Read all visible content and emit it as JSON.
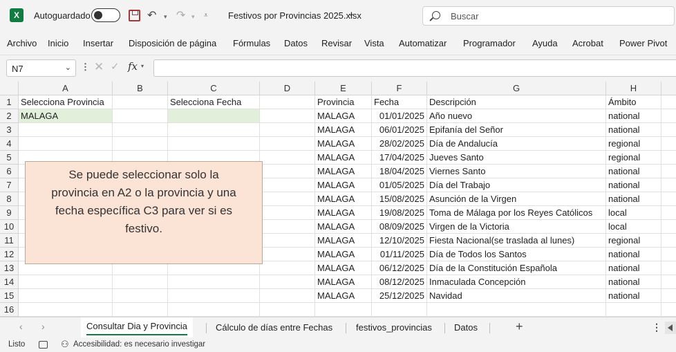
{
  "titlebar": {
    "app_icon": "excel-icon",
    "autosave_label": "Autoguardado",
    "autosave_state": "off",
    "filename": "Festivos por Provincias 2025.xlsx",
    "search_placeholder": "Buscar"
  },
  "ribbon_tabs": [
    "Archivo",
    "Inicio",
    "Insertar",
    "Disposición de página",
    "Fórmulas",
    "Datos",
    "Revisar",
    "Vista",
    "Automatizar",
    "Programador",
    "Ayuda",
    "Acrobat",
    "Power Pivot"
  ],
  "formula_bar": {
    "name_box": "N7",
    "fx_label": "fx",
    "formula": ""
  },
  "columns": [
    "A",
    "B",
    "C",
    "D",
    "E",
    "F",
    "G",
    "H"
  ],
  "rows": [
    "1",
    "2",
    "3",
    "4",
    "5",
    "6",
    "7",
    "8",
    "9",
    "10",
    "11",
    "12",
    "13",
    "14",
    "15",
    "16"
  ],
  "sheet": {
    "a1": "Selecciona Provincia",
    "a2": "MALAGA",
    "c1": "Selecciona Fecha",
    "headers": {
      "provincia": "Provincia",
      "fecha": "Fecha",
      "descripcion": "Descripción",
      "ambito": "Ámbito"
    },
    "festivos": [
      {
        "provincia": "MALAGA",
        "fecha": "01/01/2025",
        "descripcion": "Año nuevo",
        "ambito": "national"
      },
      {
        "provincia": "MALAGA",
        "fecha": "06/01/2025",
        "descripcion": "Epifanía del Señor",
        "ambito": "national"
      },
      {
        "provincia": "MALAGA",
        "fecha": "28/02/2025",
        "descripcion": "Día de Andalucía",
        "ambito": "regional"
      },
      {
        "provincia": "MALAGA",
        "fecha": "17/04/2025",
        "descripcion": "Jueves Santo",
        "ambito": "regional"
      },
      {
        "provincia": "MALAGA",
        "fecha": "18/04/2025",
        "descripcion": "Viernes Santo",
        "ambito": "national"
      },
      {
        "provincia": "MALAGA",
        "fecha": "01/05/2025",
        "descripcion": "Día del Trabajo",
        "ambito": "national"
      },
      {
        "provincia": "MALAGA",
        "fecha": "15/08/2025",
        "descripcion": "Asunción de la Virgen",
        "ambito": "national"
      },
      {
        "provincia": "MALAGA",
        "fecha": "19/08/2025",
        "descripcion": "Toma de Málaga por los Reyes Católicos",
        "ambito": "local"
      },
      {
        "provincia": "MALAGA",
        "fecha": "08/09/2025",
        "descripcion": "Virgen de la Victoria",
        "ambito": "local"
      },
      {
        "provincia": "MALAGA",
        "fecha": "12/10/2025",
        "descripcion": "Fiesta Nacional(se traslada al lunes)",
        "ambito": "regional"
      },
      {
        "provincia": "MALAGA",
        "fecha": "01/11/2025",
        "descripcion": "Día de Todos los Santos",
        "ambito": "national"
      },
      {
        "provincia": "MALAGA",
        "fecha": "06/12/2025",
        "descripcion": "Día de la Constitución Española",
        "ambito": "national"
      },
      {
        "provincia": "MALAGA",
        "fecha": "08/12/2025",
        "descripcion": "Inmaculada Concepción",
        "ambito": "national"
      },
      {
        "provincia": "MALAGA",
        "fecha": "25/12/2025",
        "descripcion": "Navidad",
        "ambito": "national"
      }
    ],
    "note_lines": [
      "Se puede seleccionar solo la",
      "provincia en A2 o la provincia y una",
      "fecha específica C3  para ver si es",
      "festivo."
    ]
  },
  "sheet_tabs": [
    "Consultar Dia y Provincia",
    "Cálculo de días entre Fechas",
    "festivos_provincias",
    "Datos"
  ],
  "active_sheet": "Consultar Dia y Provincia",
  "status": {
    "ready": "Listo",
    "accessibility": "Accesibilidad: es necesario investigar"
  },
  "colors": {
    "excel_green": "#107c41",
    "input_cell": "#e2efda",
    "note_fill": "#fbe3d6"
  }
}
